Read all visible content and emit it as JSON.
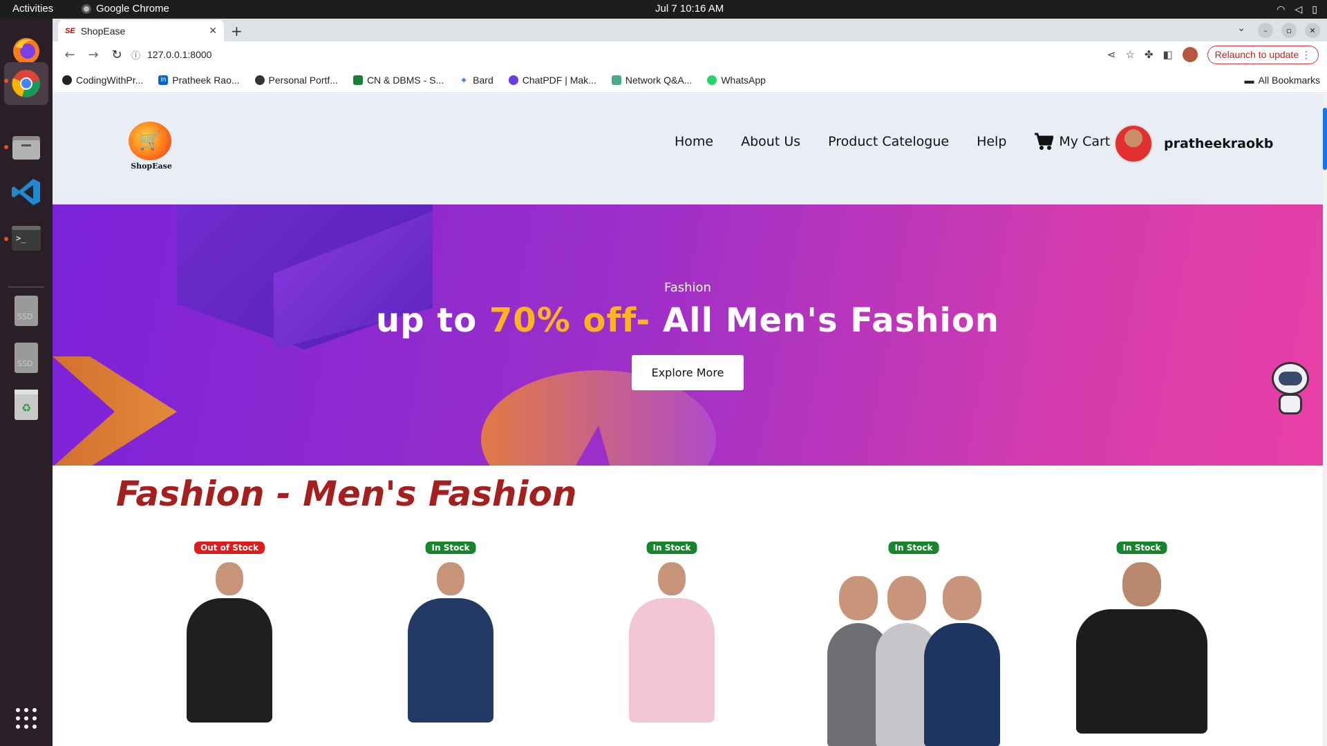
{
  "os": {
    "activities": "Activities",
    "active_app": "Google Chrome",
    "clock": "Jul 7  10:16 AM"
  },
  "browser": {
    "tab_title": "ShopEase",
    "tab_favicon": "SE",
    "url": "127.0.0.1:8000",
    "relaunch": "Relaunch to update",
    "bookmarks": [
      {
        "label": "CodingWithPr...",
        "icon": "github-icon"
      },
      {
        "label": "Pratheek Rao...",
        "icon": "linkedin-icon"
      },
      {
        "label": "Personal Portf...",
        "icon": "globe-icon"
      },
      {
        "label": "CN & DBMS - S...",
        "icon": "classroom-icon"
      },
      {
        "label": "Bard",
        "icon": "bard-icon"
      },
      {
        "label": "ChatPDF | Mak...",
        "icon": "chatpdf-icon"
      },
      {
        "label": "Network Q&A...",
        "icon": "page-icon"
      },
      {
        "label": "WhatsApp",
        "icon": "whatsapp-icon"
      }
    ],
    "all_bookmarks": "All Bookmarks"
  },
  "site": {
    "logo_name": "ShopEase",
    "nav": [
      "Home",
      "About Us",
      "Product Catelogue",
      "Help"
    ],
    "cart": "My Cart",
    "username": "pratheekraokb"
  },
  "hero": {
    "category": "Fashion",
    "headline_pre": "up to ",
    "headline_highlight": "70% off-",
    "headline_post": " All Men's Fashion",
    "cta": "Explore More"
  },
  "section": {
    "title": "Fashion - Men's Fashion"
  },
  "products": [
    {
      "stock": "Out of Stock",
      "status": "out",
      "figure": "black-suit",
      "color": "#1f1f22"
    },
    {
      "stock": "In Stock",
      "status": "in",
      "figure": "navy-suit",
      "color": "#243a66"
    },
    {
      "stock": "In Stock",
      "status": "in",
      "figure": "pink-suit",
      "color": "#f2c6d6"
    },
    {
      "stock": "In Stock",
      "status": "in",
      "figure": "tshirt-pack",
      "color": "#1e3563"
    },
    {
      "stock": "In Stock",
      "status": "in",
      "figure": "black-polo",
      "color": "#1c1c1c"
    }
  ]
}
